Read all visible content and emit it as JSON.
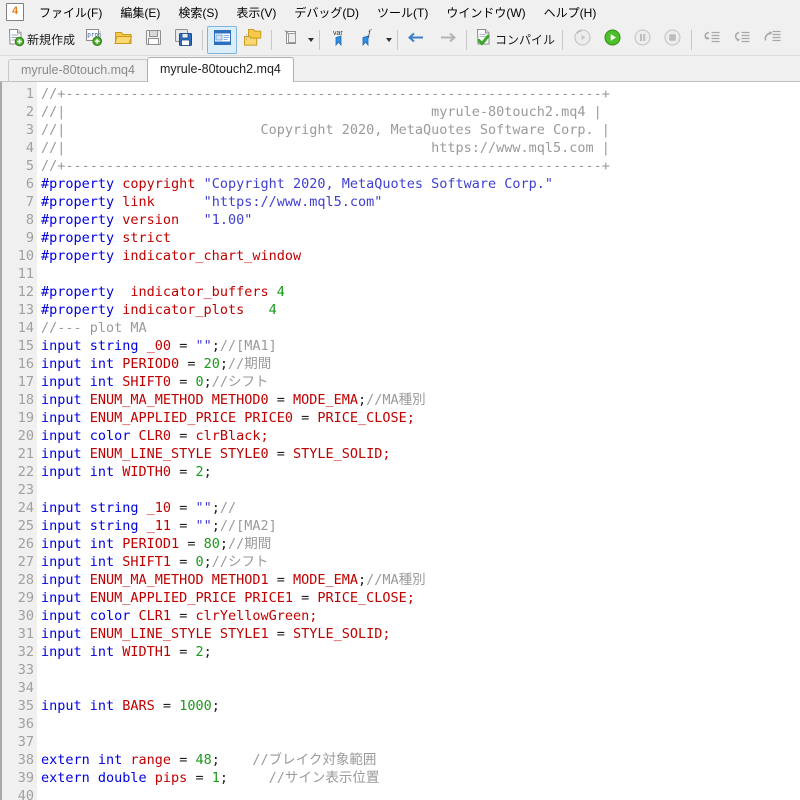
{
  "window": {
    "app_icon_label": "4"
  },
  "menubar": {
    "items": [
      {
        "label": "ファイル(F)",
        "name": "menu-file"
      },
      {
        "label": "編集(E)",
        "name": "menu-edit"
      },
      {
        "label": "検索(S)",
        "name": "menu-search"
      },
      {
        "label": "表示(V)",
        "name": "menu-view"
      },
      {
        "label": "デバッグ(D)",
        "name": "menu-debug"
      },
      {
        "label": "ツール(T)",
        "name": "menu-tools"
      },
      {
        "label": "ウインドウ(W)",
        "name": "menu-window"
      },
      {
        "label": "ヘルプ(H)",
        "name": "menu-help"
      }
    ]
  },
  "toolbar": {
    "new_label": "新規作成",
    "compile_label": "コンパイル",
    "items": [
      {
        "name": "new-file-button",
        "icon": "new-document-icon"
      },
      {
        "name": "new-project-button",
        "icon": "new-project-icon"
      },
      {
        "name": "open-file-button",
        "icon": "open-folder-icon"
      },
      {
        "name": "save-button",
        "icon": "save-disk-icon"
      },
      {
        "name": "save-all-button",
        "icon": "save-all-disk-icon"
      },
      {
        "name": "toggle-navigator-button",
        "icon": "navigator-panel-icon"
      },
      {
        "name": "toggle-toolbox-button",
        "icon": "toolbox-folder-icon"
      },
      {
        "name": "clipboard-button",
        "icon": "clipboard-icon"
      },
      {
        "name": "insert-variable-button",
        "icon": "var-pin-icon"
      },
      {
        "name": "insert-function-button",
        "icon": "function-pin-icon"
      },
      {
        "name": "navigate-back-button",
        "icon": "arrow-left-icon"
      },
      {
        "name": "navigate-forward-button",
        "icon": "arrow-right-icon"
      },
      {
        "name": "compile-button",
        "icon": "compile-check-icon"
      },
      {
        "name": "debug-history-button",
        "icon": "debug-history-icon"
      },
      {
        "name": "run-button",
        "icon": "play-icon"
      },
      {
        "name": "pause-button",
        "icon": "pause-icon"
      },
      {
        "name": "stop-button",
        "icon": "stop-icon"
      },
      {
        "name": "step-into-button",
        "icon": "step-into-icon"
      },
      {
        "name": "step-over-button",
        "icon": "step-over-icon"
      },
      {
        "name": "step-out-button",
        "icon": "step-out-icon"
      }
    ]
  },
  "tabs": [
    {
      "label": "myrule-80touch.mq4",
      "active": false,
      "name": "editor-tab-myrule-80touch"
    },
    {
      "label": "myrule-80touch2.mq4",
      "active": true,
      "name": "editor-tab-myrule-80touch2"
    }
  ],
  "editor": {
    "first_line": 1,
    "last_line": 40,
    "lines": [
      {
        "n": 1,
        "tokens": [
          {
            "t": "com",
            "s": "//+------------------------------------------------------------------+"
          }
        ]
      },
      {
        "n": 2,
        "tokens": [
          {
            "t": "com",
            "s": "//|                                             myrule-80touch2.mq4 |"
          }
        ]
      },
      {
        "n": 3,
        "tokens": [
          {
            "t": "com",
            "s": "//|                        Copyright 2020, MetaQuotes Software Corp. |"
          }
        ]
      },
      {
        "n": 4,
        "tokens": [
          {
            "t": "com",
            "s": "//|                                             https://www.mql5.com |"
          }
        ]
      },
      {
        "n": 5,
        "tokens": [
          {
            "t": "com",
            "s": "//+------------------------------------------------------------------+"
          }
        ]
      },
      {
        "n": 6,
        "tokens": [
          {
            "t": "pp",
            "s": "#property "
          },
          {
            "t": "id",
            "s": "copyright "
          },
          {
            "t": "str",
            "s": "\"Copyright 2020, MetaQuotes Software Corp.\""
          }
        ]
      },
      {
        "n": 7,
        "tokens": [
          {
            "t": "pp",
            "s": "#property "
          },
          {
            "t": "id",
            "s": "link      "
          },
          {
            "t": "str",
            "s": "\"https://www.mql5.com\""
          }
        ]
      },
      {
        "n": 8,
        "tokens": [
          {
            "t": "pp",
            "s": "#property "
          },
          {
            "t": "id",
            "s": "version   "
          },
          {
            "t": "str",
            "s": "\"1.00\""
          }
        ]
      },
      {
        "n": 9,
        "tokens": [
          {
            "t": "pp",
            "s": "#property "
          },
          {
            "t": "id",
            "s": "strict"
          }
        ]
      },
      {
        "n": 10,
        "tokens": [
          {
            "t": "pp",
            "s": "#property "
          },
          {
            "t": "id",
            "s": "indicator_chart_window"
          }
        ]
      },
      {
        "n": 11,
        "tokens": []
      },
      {
        "n": 12,
        "tokens": [
          {
            "t": "pp",
            "s": "#property "
          },
          {
            "t": "id",
            "s": " indicator_buffers "
          },
          {
            "t": "num",
            "s": "4"
          }
        ]
      },
      {
        "n": 13,
        "tokens": [
          {
            "t": "pp",
            "s": "#property "
          },
          {
            "t": "id",
            "s": "indicator_plots   "
          },
          {
            "t": "num",
            "s": "4"
          }
        ]
      },
      {
        "n": 14,
        "tokens": [
          {
            "t": "com",
            "s": "//--- plot MA"
          }
        ]
      },
      {
        "n": 15,
        "tokens": [
          {
            "t": "kw",
            "s": "input string "
          },
          {
            "t": "id",
            "s": "_00 "
          },
          {
            "t": "plain",
            "s": "= "
          },
          {
            "t": "str",
            "s": "\"\""
          },
          {
            "t": "plain",
            "s": ";"
          },
          {
            "t": "com",
            "s": "//[MA1]"
          }
        ]
      },
      {
        "n": 16,
        "tokens": [
          {
            "t": "kw",
            "s": "input int "
          },
          {
            "t": "id",
            "s": "PERIOD0 "
          },
          {
            "t": "plain",
            "s": "= "
          },
          {
            "t": "num",
            "s": "20"
          },
          {
            "t": "plain",
            "s": ";"
          },
          {
            "t": "com",
            "s": "//期間"
          }
        ]
      },
      {
        "n": 17,
        "tokens": [
          {
            "t": "kw",
            "s": "input int "
          },
          {
            "t": "id",
            "s": "SHIFT0 "
          },
          {
            "t": "plain",
            "s": "= "
          },
          {
            "t": "num",
            "s": "0"
          },
          {
            "t": "plain",
            "s": ";"
          },
          {
            "t": "com",
            "s": "//シフト"
          }
        ]
      },
      {
        "n": 18,
        "tokens": [
          {
            "t": "kw",
            "s": "input "
          },
          {
            "t": "id",
            "s": "ENUM_MA_METHOD METHOD0 "
          },
          {
            "t": "plain",
            "s": "= "
          },
          {
            "t": "id",
            "s": "MODE_EMA"
          },
          {
            "t": "plain",
            "s": ";"
          },
          {
            "t": "com",
            "s": "//MA種別"
          }
        ]
      },
      {
        "n": 19,
        "tokens": [
          {
            "t": "kw",
            "s": "input "
          },
          {
            "t": "id",
            "s": "ENUM_APPLIED_PRICE PRICE0 "
          },
          {
            "t": "plain",
            "s": "= "
          },
          {
            "t": "id",
            "s": "PRICE_CLOSE;"
          }
        ]
      },
      {
        "n": 20,
        "tokens": [
          {
            "t": "kw",
            "s": "input color "
          },
          {
            "t": "id",
            "s": "CLR0 "
          },
          {
            "t": "plain",
            "s": "= "
          },
          {
            "t": "id",
            "s": "clrBlack;"
          }
        ]
      },
      {
        "n": 21,
        "tokens": [
          {
            "t": "kw",
            "s": "input "
          },
          {
            "t": "id",
            "s": "ENUM_LINE_STYLE STYLE0 "
          },
          {
            "t": "plain",
            "s": "= "
          },
          {
            "t": "id",
            "s": "STYLE_SOLID;"
          }
        ]
      },
      {
        "n": 22,
        "tokens": [
          {
            "t": "kw",
            "s": "input int "
          },
          {
            "t": "id",
            "s": "WIDTH0 "
          },
          {
            "t": "plain",
            "s": "= "
          },
          {
            "t": "num",
            "s": "2"
          },
          {
            "t": "plain",
            "s": ";"
          }
        ]
      },
      {
        "n": 23,
        "tokens": []
      },
      {
        "n": 24,
        "tokens": [
          {
            "t": "kw",
            "s": "input string "
          },
          {
            "t": "id",
            "s": "_10 "
          },
          {
            "t": "plain",
            "s": "= "
          },
          {
            "t": "str",
            "s": "\"\""
          },
          {
            "t": "plain",
            "s": ";"
          },
          {
            "t": "com",
            "s": "//"
          }
        ]
      },
      {
        "n": 25,
        "tokens": [
          {
            "t": "kw",
            "s": "input string "
          },
          {
            "t": "id",
            "s": "_11 "
          },
          {
            "t": "plain",
            "s": "= "
          },
          {
            "t": "str",
            "s": "\"\""
          },
          {
            "t": "plain",
            "s": ";"
          },
          {
            "t": "com",
            "s": "//[MA2]"
          }
        ]
      },
      {
        "n": 26,
        "tokens": [
          {
            "t": "kw",
            "s": "input int "
          },
          {
            "t": "id",
            "s": "PERIOD1 "
          },
          {
            "t": "plain",
            "s": "= "
          },
          {
            "t": "num",
            "s": "80"
          },
          {
            "t": "plain",
            "s": ";"
          },
          {
            "t": "com",
            "s": "//期間"
          }
        ]
      },
      {
        "n": 27,
        "tokens": [
          {
            "t": "kw",
            "s": "input int "
          },
          {
            "t": "id",
            "s": "SHIFT1 "
          },
          {
            "t": "plain",
            "s": "= "
          },
          {
            "t": "num",
            "s": "0"
          },
          {
            "t": "plain",
            "s": ";"
          },
          {
            "t": "com",
            "s": "//シフト"
          }
        ]
      },
      {
        "n": 28,
        "tokens": [
          {
            "t": "kw",
            "s": "input "
          },
          {
            "t": "id",
            "s": "ENUM_MA_METHOD METHOD1 "
          },
          {
            "t": "plain",
            "s": "= "
          },
          {
            "t": "id",
            "s": "MODE_EMA"
          },
          {
            "t": "plain",
            "s": ";"
          },
          {
            "t": "com",
            "s": "//MA種別"
          }
        ]
      },
      {
        "n": 29,
        "tokens": [
          {
            "t": "kw",
            "s": "input "
          },
          {
            "t": "id",
            "s": "ENUM_APPLIED_PRICE PRICE1 "
          },
          {
            "t": "plain",
            "s": "= "
          },
          {
            "t": "id",
            "s": "PRICE_CLOSE;"
          }
        ]
      },
      {
        "n": 30,
        "tokens": [
          {
            "t": "kw",
            "s": "input color "
          },
          {
            "t": "id",
            "s": "CLR1 "
          },
          {
            "t": "plain",
            "s": "= "
          },
          {
            "t": "id",
            "s": "clrYellowGreen;"
          }
        ]
      },
      {
        "n": 31,
        "tokens": [
          {
            "t": "kw",
            "s": "input "
          },
          {
            "t": "id",
            "s": "ENUM_LINE_STYLE STYLE1 "
          },
          {
            "t": "plain",
            "s": "= "
          },
          {
            "t": "id",
            "s": "STYLE_SOLID;"
          }
        ]
      },
      {
        "n": 32,
        "tokens": [
          {
            "t": "kw",
            "s": "input int "
          },
          {
            "t": "id",
            "s": "WIDTH1 "
          },
          {
            "t": "plain",
            "s": "= "
          },
          {
            "t": "num",
            "s": "2"
          },
          {
            "t": "plain",
            "s": ";"
          }
        ]
      },
      {
        "n": 33,
        "tokens": []
      },
      {
        "n": 34,
        "tokens": []
      },
      {
        "n": 35,
        "tokens": [
          {
            "t": "kw",
            "s": "input int "
          },
          {
            "t": "id",
            "s": "BARS "
          },
          {
            "t": "plain",
            "s": "= "
          },
          {
            "t": "num",
            "s": "1000"
          },
          {
            "t": "plain",
            "s": ";"
          }
        ]
      },
      {
        "n": 36,
        "tokens": []
      },
      {
        "n": 37,
        "tokens": []
      },
      {
        "n": 38,
        "tokens": [
          {
            "t": "kw",
            "s": "extern int "
          },
          {
            "t": "id",
            "s": "range "
          },
          {
            "t": "plain",
            "s": "= "
          },
          {
            "t": "num",
            "s": "48"
          },
          {
            "t": "plain",
            "s": ";    "
          },
          {
            "t": "com",
            "s": "//ブレイク対象範囲"
          }
        ]
      },
      {
        "n": 39,
        "tokens": [
          {
            "t": "kw",
            "s": "extern double "
          },
          {
            "t": "id",
            "s": "pips "
          },
          {
            "t": "plain",
            "s": "= "
          },
          {
            "t": "num",
            "s": "1"
          },
          {
            "t": "plain",
            "s": ";     "
          },
          {
            "t": "com",
            "s": "//サイン表示位置"
          }
        ]
      },
      {
        "n": 40,
        "tokens": []
      }
    ]
  },
  "colors": {
    "keyword": "#0000e0",
    "identifier": "#c00000",
    "number": "#1a9a1a",
    "comment": "#9a9a9a",
    "string": "#4040d0",
    "gutter_bg": "#f0f0f0",
    "editor_bg": "#ffffff",
    "chrome_bg": "#f0f0f0"
  }
}
